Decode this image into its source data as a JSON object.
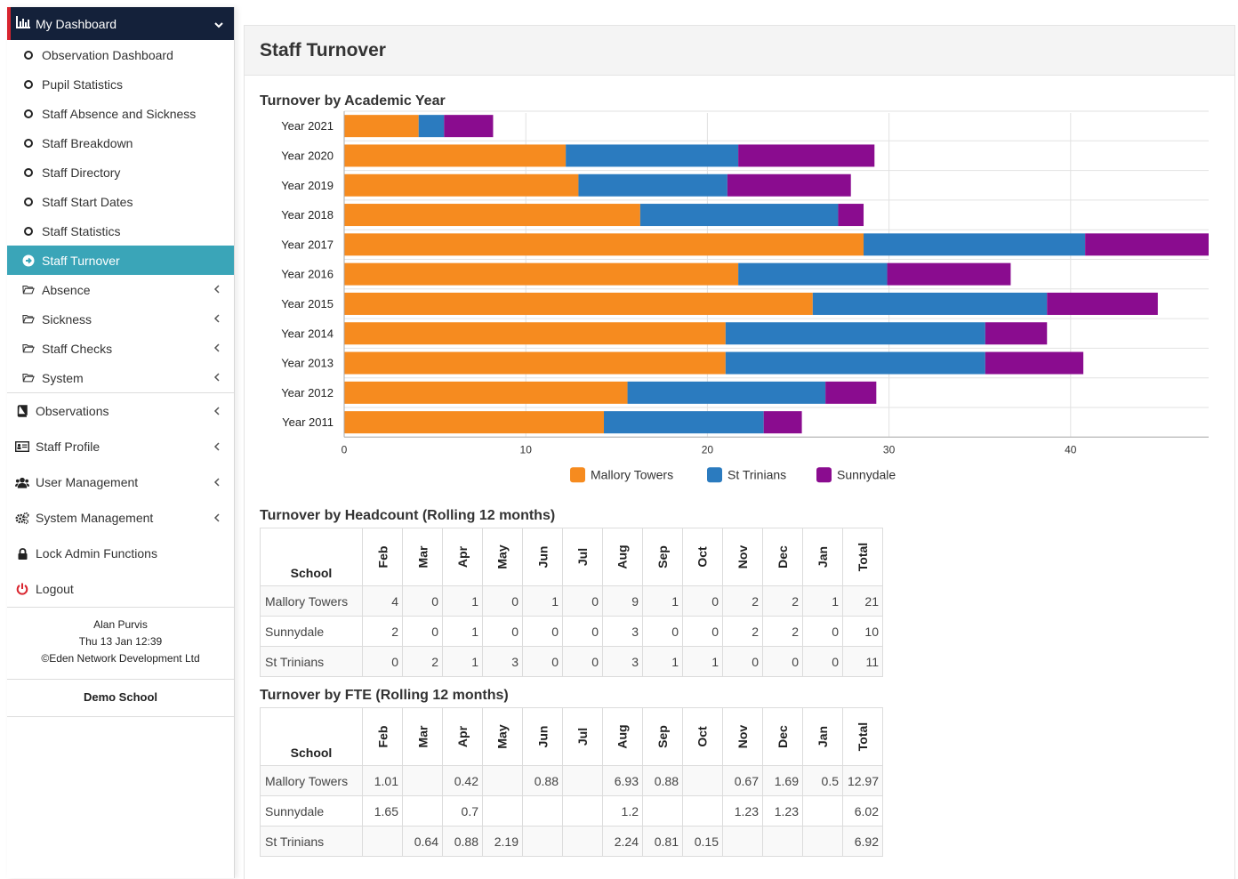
{
  "sidebar": {
    "header": "My Dashboard",
    "sub_items": [
      {
        "label": "Observation Dashboard",
        "icon": "circle-icon"
      },
      {
        "label": "Pupil Statistics",
        "icon": "circle-icon"
      },
      {
        "label": "Staff Absence and Sickness",
        "icon": "circle-icon"
      },
      {
        "label": "Staff Breakdown",
        "icon": "circle-icon"
      },
      {
        "label": "Staff Directory",
        "icon": "circle-icon"
      },
      {
        "label": "Staff Start Dates",
        "icon": "circle-icon"
      },
      {
        "label": "Staff Statistics",
        "icon": "circle-icon"
      },
      {
        "label": "Staff Turnover",
        "icon": "arrow-circle-right-icon",
        "active": true
      }
    ],
    "folders": [
      {
        "label": "Absence",
        "icon": "folder-open-icon"
      },
      {
        "label": "Sickness",
        "icon": "folder-open-icon"
      },
      {
        "label": "Staff Checks",
        "icon": "folder-open-icon"
      },
      {
        "label": "System",
        "icon": "folder-open-icon"
      }
    ],
    "main_items": [
      {
        "label": "Observations",
        "icon": "book-icon"
      },
      {
        "label": "Staff Profile",
        "icon": "id-card-icon"
      },
      {
        "label": "User Management",
        "icon": "users-icon"
      },
      {
        "label": "System Management",
        "icon": "cogs-icon"
      },
      {
        "label": "Lock Admin Functions",
        "icon": "lock-icon"
      },
      {
        "label": "Logout",
        "icon": "power-icon"
      }
    ],
    "footer": {
      "user": "Alan Purvis",
      "datetime": "Thu 13 Jan 12:39",
      "copyright": "©Eden Network Development Ltd"
    },
    "school": "Demo School"
  },
  "main": {
    "title": "Staff Turnover",
    "chart_title": "Turnover by Academic Year",
    "headcount_title": "Turnover by Headcount (Rolling 12 months)",
    "fte_title": "Turnover by FTE (Rolling 12 months)"
  },
  "colors": {
    "mallory": "#f68b1f",
    "st_trinians": "#2b7bbf",
    "sunnydale": "#8a0c8f",
    "active_nav": "#3aa5b8",
    "sidebar_header": "#14213a",
    "logout": "#d9252f"
  },
  "chart_data": {
    "type": "bar",
    "orientation": "horizontal",
    "stacked": true,
    "title": "Turnover by Academic Year",
    "categories": [
      "Year 2021",
      "Year 2020",
      "Year 2019",
      "Year 2018",
      "Year 2017",
      "Year 2016",
      "Year 2015",
      "Year 2014",
      "Year 2013",
      "Year 2012",
      "Year 2011"
    ],
    "series": [
      {
        "name": "Mallory Towers",
        "color": "#f68b1f",
        "values": [
          4.1,
          12.2,
          12.9,
          16.3,
          28.6,
          21.7,
          25.8,
          21.0,
          21.0,
          15.6,
          14.3
        ]
      },
      {
        "name": "St Trinians",
        "color": "#2b7bbf",
        "values": [
          1.4,
          9.5,
          8.2,
          10.9,
          12.2,
          8.2,
          12.9,
          14.3,
          14.3,
          10.9,
          8.8
        ]
      },
      {
        "name": "Sunnydale",
        "color": "#8a0c8f",
        "values": [
          2.7,
          7.5,
          6.8,
          1.4,
          6.8,
          6.8,
          6.1,
          3.4,
          5.4,
          2.8,
          2.1
        ]
      }
    ],
    "xlim": [
      0,
      47.6
    ],
    "xticks": [
      "0",
      "10",
      "20",
      "30",
      "40"
    ],
    "grid": true,
    "legend": "bottom"
  },
  "headcount_table": {
    "school_header": "School",
    "months": [
      "Feb",
      "Mar",
      "Apr",
      "May",
      "Jun",
      "Jul",
      "Aug",
      "Sep",
      "Oct",
      "Nov",
      "Dec",
      "Jan"
    ],
    "total_header": "Total",
    "rows": [
      {
        "school": "Mallory Towers",
        "values": [
          "4",
          "0",
          "1",
          "0",
          "1",
          "0",
          "9",
          "1",
          "0",
          "2",
          "2",
          "1"
        ],
        "total": "21"
      },
      {
        "school": "Sunnydale",
        "values": [
          "2",
          "0",
          "1",
          "0",
          "0",
          "0",
          "3",
          "0",
          "0",
          "2",
          "2",
          "0"
        ],
        "total": "10"
      },
      {
        "school": "St Trinians",
        "values": [
          "0",
          "2",
          "1",
          "3",
          "0",
          "0",
          "3",
          "1",
          "1",
          "0",
          "0",
          "0"
        ],
        "total": "11"
      }
    ]
  },
  "fte_table": {
    "school_header": "School",
    "months": [
      "Feb",
      "Mar",
      "Apr",
      "May",
      "Jun",
      "Jul",
      "Aug",
      "Sep",
      "Oct",
      "Nov",
      "Dec",
      "Jan"
    ],
    "total_header": "Total",
    "rows": [
      {
        "school": "Mallory Towers",
        "values": [
          "1.01",
          "",
          "0.42",
          "",
          "0.88",
          "",
          "6.93",
          "0.88",
          "",
          "0.67",
          "1.69",
          "0.5"
        ],
        "total": "12.97"
      },
      {
        "school": "Sunnydale",
        "values": [
          "1.65",
          "",
          "0.7",
          "",
          "",
          "",
          "1.2",
          "",
          "",
          "1.23",
          "1.23",
          ""
        ],
        "total": "6.02"
      },
      {
        "school": "St Trinians",
        "values": [
          "",
          "0.64",
          "0.88",
          "2.19",
          "",
          "",
          "2.24",
          "0.81",
          "0.15",
          "",
          "",
          ""
        ],
        "total": "6.92"
      }
    ]
  }
}
